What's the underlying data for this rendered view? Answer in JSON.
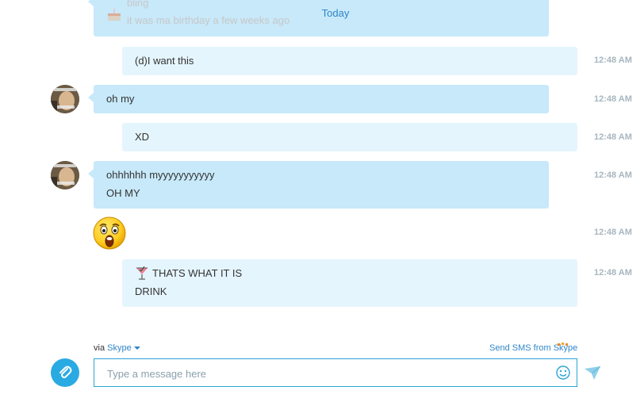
{
  "date_divider": "Today",
  "quoted": {
    "name": "bling",
    "text": "it was ma birthday a few weeks ago"
  },
  "messages": [
    {
      "lines": [
        "(d)I want this"
      ],
      "time": "12:48 AM"
    },
    {
      "lines": [
        "oh my"
      ],
      "time": "12:48 AM"
    },
    {
      "lines": [
        "XD"
      ],
      "time": "12:48 AM"
    },
    {
      "lines": [
        "ohhhhhh myyyyyyyyyyy",
        "OH MY"
      ],
      "time": "12:48 AM"
    },
    {
      "emoticon": "surprised-emoticon",
      "time": "12:48 AM"
    },
    {
      "lines": [
        "THATS WHAT IT IS",
        "DRINK"
      ],
      "time": "12:48 AM",
      "emoji": "cocktail-icon"
    }
  ],
  "footer": {
    "via_label": "via",
    "via_service": "Skype",
    "sms_link": "Send SMS from Skype",
    "input_placeholder": "Type a message here"
  },
  "colors": {
    "accent": "#2aaae2",
    "incoming_bubble": "#c7e9fa",
    "outgoing_bubble": "#e5f5fd",
    "link": "#2f86c8"
  }
}
